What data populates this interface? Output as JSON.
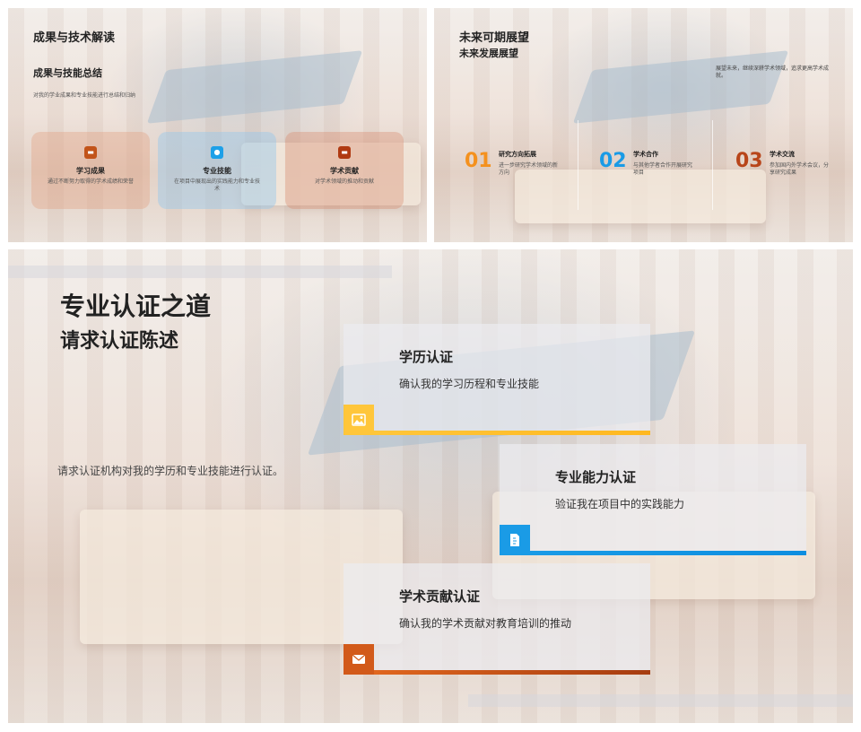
{
  "slide1": {
    "title": "成果与技术解读",
    "subtitle": "成果与技能总结",
    "desc": "对我的学业成果和专业技能进行总结和归纳",
    "cards": [
      {
        "title": "学习成果",
        "desc": "通过不断努力取得的学术成绩和荣誉",
        "icon": "chat-icon",
        "color": "#c2541a"
      },
      {
        "title": "专业技能",
        "desc": "在项目中展现出的实践能力和专业技术",
        "icon": "gear-icon",
        "color": "#1ea0e8"
      },
      {
        "title": "学术贡献",
        "desc": "对学术领域的推动和贡献",
        "icon": "message-icon",
        "color": "#b03a12"
      }
    ]
  },
  "slide2": {
    "title": "未来可期展望",
    "subtitle": "未来发展展望",
    "intro": "展望未来，继续深耕学术领域，追求更高学术成就。",
    "items": [
      {
        "num": "01",
        "title": "研究方向拓展",
        "desc": "进一步研究学术领域的新方向",
        "color": "#f4911e"
      },
      {
        "num": "02",
        "title": "学术合作",
        "desc": "与其他学者合作开展研究项目",
        "color": "#1a9be6"
      },
      {
        "num": "03",
        "title": "学术交流",
        "desc": "参加国内外学术会议，分享研究成果",
        "color": "#b8451a"
      }
    ]
  },
  "slide3": {
    "title": "专业认证之道",
    "subtitle": "请求认证陈述",
    "lead": "请求认证机构对我的学历和专业技能进行认证。",
    "boxes": [
      {
        "title": "学历认证",
        "desc": "确认我的学习历程和专业技能",
        "icon": "image-icon",
        "color": "#ffc63a"
      },
      {
        "title": "专业能力认证",
        "desc": "验证我在项目中的实践能力",
        "icon": "document-icon",
        "color": "#1a9be6"
      },
      {
        "title": "学术贡献认证",
        "desc": "确认我的学术贡献对教育培训的推动",
        "icon": "mail-icon",
        "color": "#d25a1a"
      }
    ]
  }
}
